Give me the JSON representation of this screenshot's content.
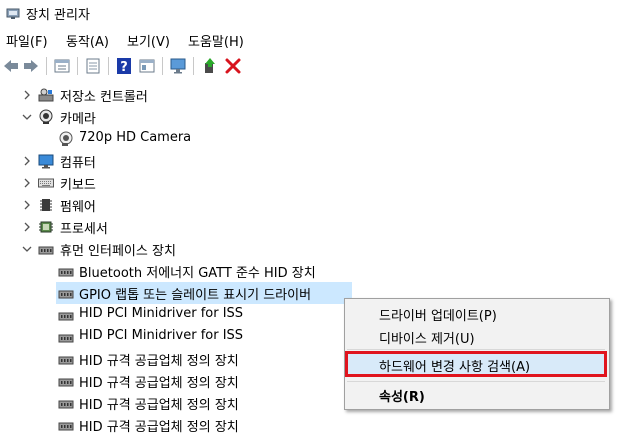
{
  "window": {
    "title": "장치 관리자"
  },
  "menu": {
    "file": "파일(F)",
    "action": "동작(A)",
    "view": "보기(V)",
    "help": "도움말(H)"
  },
  "toolbar": {
    "icons": [
      "back-icon",
      "forward-icon",
      "properties-view-icon",
      "show-hide-icon",
      "help-icon",
      "view-icon",
      "monitor-icon",
      "update-driver-icon",
      "uninstall-icon"
    ],
    "uninstall_color": "#d8141e",
    "help_color": "#1a3aa8"
  },
  "tree": {
    "items": [
      {
        "label": "저장소 컨트롤러",
        "expanded": false
      },
      {
        "label": "카메라",
        "expanded": true
      },
      {
        "label": "720p HD Camera",
        "child": true
      },
      {
        "label": "컴퓨터",
        "expanded": false
      },
      {
        "label": "키보드",
        "expanded": false
      },
      {
        "label": "펌웨어",
        "expanded": false
      },
      {
        "label": "프로세서",
        "expanded": false
      },
      {
        "label": "휴먼 인터페이스 장치",
        "expanded": true
      },
      {
        "label": "Bluetooth 저에너지 GATT 준수 HID 장치",
        "child": true
      },
      {
        "label": "GPIO 랩톱 또는 슬레이트 표시기 드라이버",
        "child": true,
        "selected": true
      },
      {
        "label": "HID PCI Minidriver for ISS",
        "child": true
      },
      {
        "label": "HID PCI Minidriver for ISS",
        "child": true
      },
      {
        "label": "HID 규격 공급업체 정의 장치",
        "child": true
      },
      {
        "label": "HID 규격 공급업체 정의 장치",
        "child": true
      },
      {
        "label": "HID 규격 공급업체 정의 장치",
        "child": true
      },
      {
        "label": "HID 규격 공급업체 정의 장치",
        "child": true
      }
    ]
  },
  "context_menu": {
    "update_driver": "드라이버 업데이트(P)",
    "disable_device": "디바이스 제거(U)",
    "scan_changes": "하드웨어 변경 사항 검색(A)",
    "properties": "속성(R)",
    "highlight_color": "#e0141e"
  }
}
